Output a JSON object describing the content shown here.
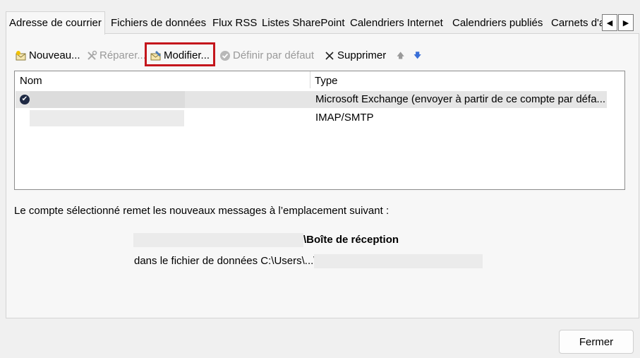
{
  "tabs": [
    {
      "label": "Adresse de courrier",
      "active": true
    },
    {
      "label": "Fichiers de données"
    },
    {
      "label": "Flux RSS"
    },
    {
      "label": "Listes SharePoint"
    },
    {
      "label": "Calendriers Internet"
    },
    {
      "label": "Calendriers publiés"
    },
    {
      "label": "Carnets d'a"
    }
  ],
  "tab_scroll": {
    "left": "◀",
    "right": "▶"
  },
  "toolbar": {
    "new_label": "Nouveau...",
    "repair_label": "Réparer...",
    "modify_label": "Modifier...",
    "default_label": "Définir par défaut",
    "delete_label": "Supprimer",
    "up_arrow": "🡅",
    "down_arrow": "🡇"
  },
  "list": {
    "col_name": "Nom",
    "col_type": "Type",
    "rows": [
      {
        "type": "Microsoft Exchange (envoyer à partir de ce compte par défa...",
        "default": true
      },
      {
        "type": "IMAP/SMTP"
      }
    ],
    "check_glyph": "✔"
  },
  "info_text": "Le compte sélectionné remet les nouveaux messages à l’emplacement suivant :",
  "inbox_label": "\\Boîte de réception",
  "datafile_label": "dans le fichier de données C:\\Users\\...\\",
  "close_label": "Fermer",
  "colors": {
    "highlight": "#c4161c",
    "check": "#1f2a44"
  }
}
